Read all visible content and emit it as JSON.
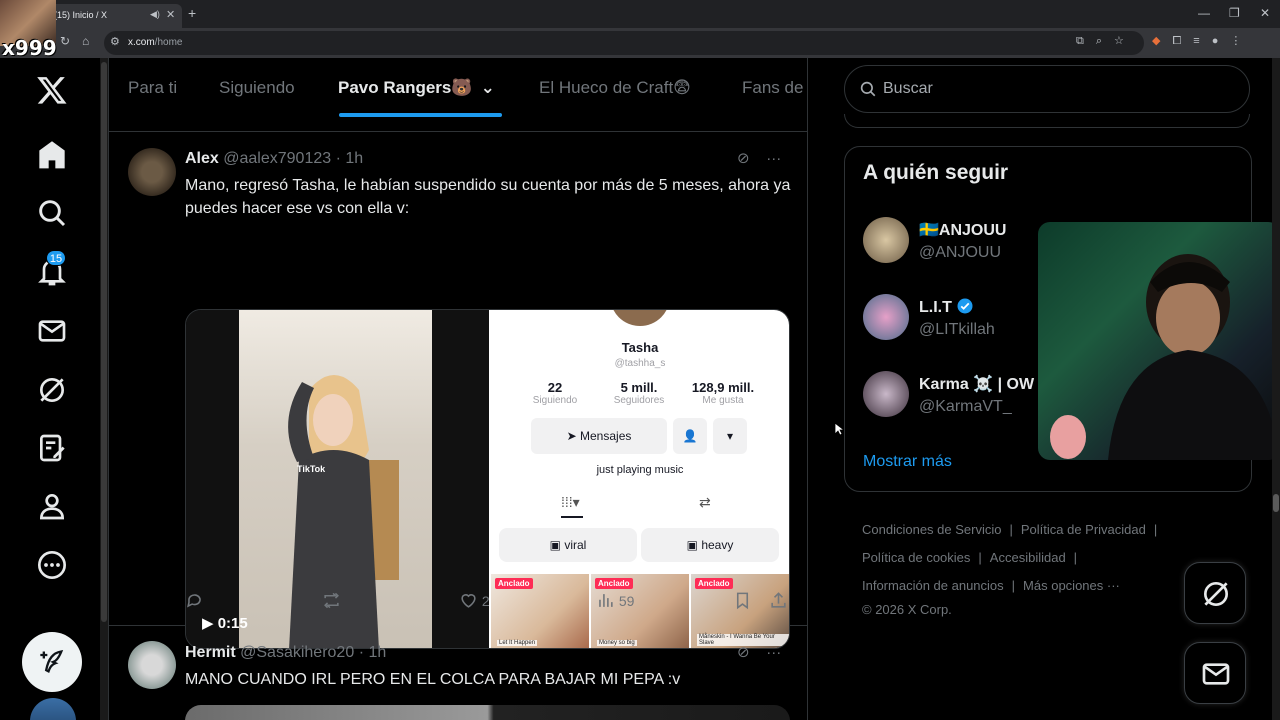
{
  "browser": {
    "tab_title": "(15) Inicio / X",
    "url_host": "x.com",
    "url_path": "/home"
  },
  "overlay": {
    "streamer_tag": "x999"
  },
  "nav": {
    "notifications_count": "15",
    "items": [
      "x-logo-icon",
      "home-icon",
      "search-icon",
      "bell-icon",
      "mail-icon",
      "grok-icon",
      "lists-icon",
      "profile-icon",
      "more-icon"
    ]
  },
  "feed_tabs": [
    {
      "label": "Para ti"
    },
    {
      "label": "Siguiendo"
    },
    {
      "label": "Pavo Rangers🐻"
    },
    {
      "label": "El Hueco de Craft😨"
    },
    {
      "label": "Fans de"
    }
  ],
  "tweets": [
    {
      "name": "Alex",
      "handle": "@aalex790123",
      "dot": "·",
      "time": "1h",
      "text": "Mano, regresó  Tasha, le habían suspendido su cuenta por más de 5 meses, ahora ya puedes hacer ese vs con ella v:",
      "video_duration": "0:15",
      "tiktok_label": "TikTok",
      "profile": {
        "name": "Tasha",
        "username": "@tashha_s",
        "stats": [
          {
            "value": "22",
            "label": "Siguiendo"
          },
          {
            "value": "5 mill.",
            "label": "Seguidores"
          },
          {
            "value": "128,9 mill.",
            "label": "Me gusta"
          }
        ],
        "message_button": "Mensajes",
        "bio": "just playing music",
        "chips": [
          "viral",
          "heavy"
        ],
        "pinned_label": "Anclado",
        "thumb_captions": [
          "Let It Happen",
          "Money so big",
          "Måneskin - I Wanna Be Your Slave"
        ]
      },
      "replies": "",
      "reposts": "",
      "likes": "2",
      "views": "59"
    },
    {
      "name": "Hermit",
      "handle": "@Sasakihero20",
      "dot": "·",
      "time": "1h",
      "text": "MANO CUANDO IRL PERO EN EL COLCA PARA BAJAR MI PEPA :v"
    }
  ],
  "right": {
    "search_placeholder": "Buscar",
    "who_to_follow_title": "A quién seguir",
    "accounts": [
      {
        "name": "🇸🇪ANJOUU",
        "handle": "@ANJOUU",
        "verified": false
      },
      {
        "name": "L.I.T",
        "handle": "@LITkillah",
        "verified": true
      },
      {
        "name": "Karma ☠️ | OW",
        "handle": "@KarmaVT_",
        "verified": false
      }
    ],
    "show_more": "Mostrar más",
    "footer_links": [
      "Condiciones de Servicio",
      "Política de Privacidad",
      "Política de cookies",
      "Accesibilidad",
      "Información de anuncios",
      "Más opciones ···"
    ],
    "copyright": "© 2026 X Corp.",
    "separator": "|"
  },
  "colors": {
    "accent": "#1d9bf0",
    "bg": "#000000",
    "border": "#2f3336",
    "muted": "#71767b",
    "tiktok_pink": "#fe2c55"
  }
}
